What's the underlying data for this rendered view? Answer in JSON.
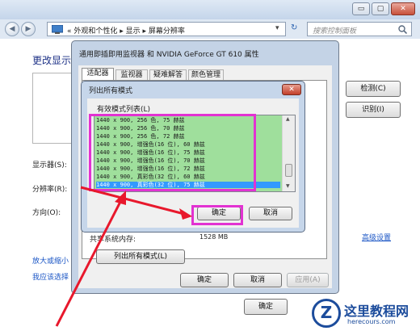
{
  "cp": {
    "caption_buttons": [
      "▭",
      "▢",
      "✕"
    ],
    "nav_back": "◀",
    "nav_forward": "▶",
    "breadcrumb": "« 外观和个性化 ▸ 显示 ▸ 屏幕分辨率",
    "addr_dropdown": "▾",
    "refresh": "↻",
    "search_placeholder": "搜索控制面板",
    "heading": "更改显示",
    "detect_button": "检测(C)",
    "identify_button": "识别(I)",
    "display_label": "显示器(S):",
    "resolution_label": "分辨率(R):",
    "orientation_label": "方向(O):",
    "link_advanced": "高级设置",
    "link_bigger_1": "放大或缩小",
    "link_bigger_2": "我应该选择",
    "ok_button": "确定"
  },
  "props": {
    "title": "通用即插即用监视器 和 NVIDIA GeForce GT 610 属性",
    "tabs": [
      "适配器",
      "监视器",
      "疑难解答",
      "颜色管理"
    ],
    "memory_label": "共享系统内存:",
    "memory_value": "1528 MB",
    "list_all_modes": "列出所有模式(L)",
    "ok": "确定",
    "cancel": "取消",
    "apply": "应用(A)"
  },
  "dialog": {
    "title": "列出所有模式",
    "close": "✕",
    "list_label": "有效模式列表(L)",
    "modes": [
      "1440 x 900, 256 色, 75 赫兹",
      "1440 x 900, 256 色, 70 赫兹",
      "1440 x 900, 256 色, 72 赫兹",
      "1440 x 900, 增强色(16 位), 60 赫兹",
      "1440 x 900, 增强色(16 位), 75 赫兹",
      "1440 x 900, 增强色(16 位), 70 赫兹",
      "1440 x 900, 增强色(16 位), 72 赫兹",
      "1440 x 900, 真彩色(32 位), 60 赫兹",
      "1440 x 900, 真彩色(32 位), 75 赫兹"
    ],
    "selected_index": 8,
    "scroll_up": "▲",
    "scroll_down": "▼",
    "ok": "确定",
    "cancel": "取消"
  },
  "watermark": {
    "logo_letter": "Z",
    "site_name": "这里教程网",
    "site_domain": "herecours.com"
  },
  "colors": {
    "list_bg": "#9fdf9c",
    "selection": "#3399ff",
    "highlight": "#e232d2",
    "arrow": "#e8182c",
    "link": "#1a55c5"
  }
}
